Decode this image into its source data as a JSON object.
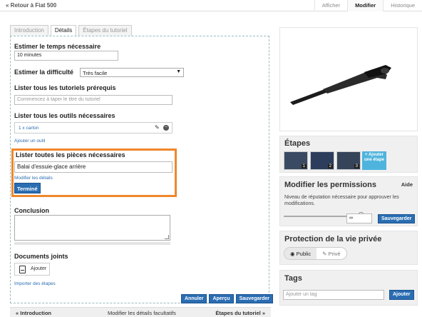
{
  "topbar": {
    "back_link": "« Retour à Fiat 500",
    "tabs": [
      "Afficher",
      "Modifier",
      "Historique"
    ]
  },
  "editor": {
    "tabs": [
      "Introduction",
      "Détails",
      "Étapes du tutoriel"
    ],
    "time_label": "Estimer le temps nécessaire",
    "time_value": "10 minutes",
    "difficulty_label": "Estimer la difficulté",
    "difficulty_value": "Très facile",
    "prereq_label": "Lister tous les tutoriels prérequis",
    "prereq_placeholder": "Commencez à taper le titre du tutoriel",
    "tools_label": "Lister tous les outils nécessaires",
    "tools": [
      "1 x carton"
    ],
    "add_tool": "Ajouter un outil",
    "parts_label": "Lister toutes les pièces nécessaires",
    "part_value": "Balai d'essuie-glace arrière",
    "edit_details": "Modifier les détails",
    "done_button": "Terminé",
    "conclusion_label": "Conclusion",
    "docs_label": "Documents joints",
    "add_doc": "Ajouter",
    "import_steps": "Importer des étapes"
  },
  "actions": [
    "Annuler",
    "Aperçu",
    "Sauvegarder"
  ],
  "bottom_nav": {
    "prev": "« Introduction",
    "middle": "Modifier les détails facultatifs",
    "next": "Étapes du tutoriel »"
  },
  "sidebar": {
    "steps_title": "Étapes",
    "step_numbers": [
      "1",
      "2",
      "3"
    ],
    "add_step": "+ Ajouter une étape",
    "permissions_title": "Modifier les permissions",
    "permissions_help": "Aide",
    "permissions_text": "Niveau de réputation nécessaire pour approuver les modifications.",
    "permissions_value": "∞",
    "permissions_save": "Sauvegarder",
    "privacy_title": "Protection de la vie privée",
    "privacy_public": "Public",
    "privacy_private": "Privé",
    "tags_title": "Tags",
    "tags_placeholder": "Ajouter un tag",
    "tags_add": "Ajouter"
  },
  "colors": {
    "accent_blue": "#2a6db2",
    "highlight_orange": "#f0872b",
    "add_step_blue": "#4fb4dd"
  }
}
